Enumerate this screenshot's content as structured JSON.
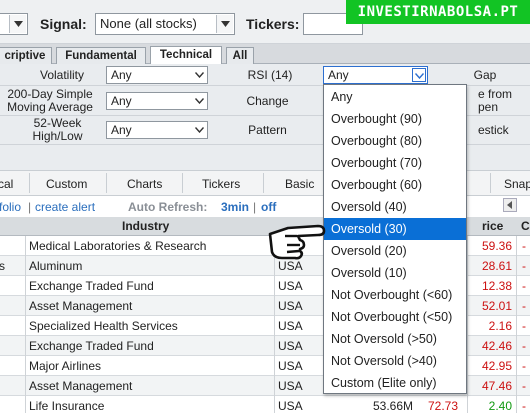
{
  "toolbar": {
    "signal_label": "Signal:",
    "signal_value": "None (all stocks)",
    "tickers_label": "Tickers:",
    "tickers_value": ""
  },
  "brand": "INVESTIRNABOLSA.PT",
  "tabs": [
    {
      "label": "criptive",
      "active": false
    },
    {
      "label": "Fundamental",
      "active": false
    },
    {
      "label": "Technical",
      "active": true
    },
    {
      "label": "All",
      "active": false
    }
  ],
  "filters": {
    "volatility": {
      "label": "Volatility",
      "value": "Any"
    },
    "rsi": {
      "label": "RSI (14)",
      "value": "Any"
    },
    "gap": {
      "label": "Gap"
    },
    "sma200": {
      "label_line1": "200-Day Simple",
      "label_line2": "Moving Average",
      "value": "Any"
    },
    "change": {
      "label": "Change"
    },
    "change_from_open": {
      "label_line1": "e from",
      "label_line2": "pen"
    },
    "high_low_52": {
      "label_line1": "52-Week",
      "label_line2": "High/Low",
      "value": "Any"
    },
    "pattern": {
      "label": "Pattern"
    },
    "candlestick": {
      "label": "estick"
    }
  },
  "views": [
    "cal",
    "Custom",
    "Charts",
    "Tickers",
    "Basic",
    "Snap"
  ],
  "links": {
    "portfolio": "folio",
    "sep": "|",
    "create_alert": "create alert",
    "auto_refresh_label": "Auto Refresh:",
    "auto_refresh_value": "3min",
    "off": "off"
  },
  "table": {
    "headers": {
      "industry": "Industry",
      "price": "rice",
      "change": "C"
    },
    "rows": [
      {
        "prefix": "",
        "industry": "Medical Laboratories & Research",
        "country": "",
        "market_cap": "",
        "pe": "",
        "price": "59.36",
        "change": "-"
      },
      {
        "prefix": "s",
        "industry": "Aluminum",
        "country": "USA",
        "market_cap": "",
        "pe": "",
        "price": "28.61",
        "change": "-"
      },
      {
        "prefix": "",
        "industry": "Exchange Traded Fund",
        "country": "USA",
        "market_cap": "",
        "pe": "",
        "price": "12.38",
        "change": "-"
      },
      {
        "prefix": "",
        "industry": "Asset Management",
        "country": "USA",
        "market_cap": "",
        "pe": "",
        "price": "52.01",
        "change": "-"
      },
      {
        "prefix": "",
        "industry": "Specialized Health Services",
        "country": "USA",
        "market_cap": "",
        "pe": "",
        "price": "2.16",
        "change": "-"
      },
      {
        "prefix": "",
        "industry": "Exchange Traded Fund",
        "country": "USA",
        "market_cap": "",
        "pe": "",
        "price": "42.46",
        "change": "-"
      },
      {
        "prefix": "",
        "industry": "Major Airlines",
        "country": "USA",
        "market_cap": "",
        "pe": "",
        "price": "42.95",
        "change": "-"
      },
      {
        "prefix": "",
        "industry": "Asset Management",
        "country": "USA",
        "market_cap": "",
        "pe": "",
        "price": "47.46",
        "change": "-"
      },
      {
        "prefix": "",
        "industry": "Life Insurance",
        "country": "USA",
        "market_cap": "53.66M",
        "pe": "72.73",
        "price": "2.40",
        "change": "-"
      }
    ]
  },
  "rsi_options": [
    "Any",
    "Overbought (90)",
    "Overbought (80)",
    "Overbought (70)",
    "Overbought (60)",
    "Oversold (40)",
    "Oversold (30)",
    "Oversold (20)",
    "Oversold (10)",
    "Not Overbought (<60)",
    "Not Overbought (<50)",
    "Not Oversold (>50)",
    "Not Oversold (>40)",
    "Custom (Elite only)"
  ],
  "highlighted_option": "Oversold (30)",
  "colors": {
    "accent": "#0a6fd6",
    "brand": "#12c424",
    "negative": "#cc1111",
    "positive": "#119911"
  }
}
